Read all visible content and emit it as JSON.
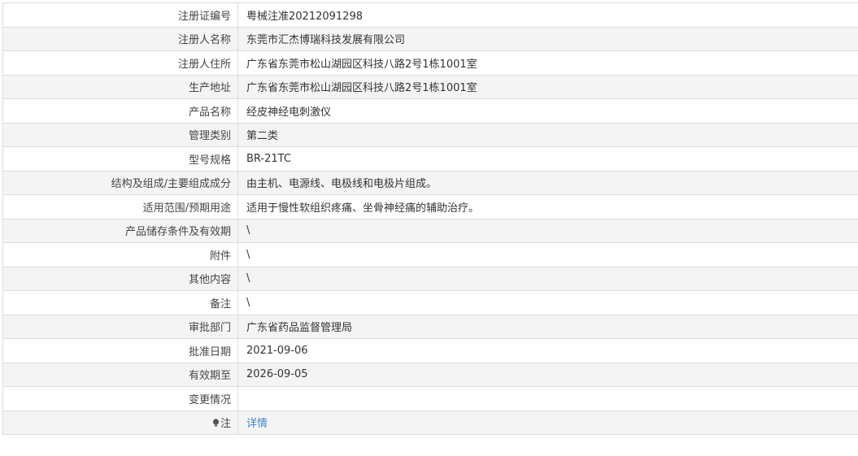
{
  "rows": [
    {
      "label": "注册证编号",
      "value": "粤械注准20212091298"
    },
    {
      "label": "注册人名称",
      "value": "东莞市汇杰博瑞科技发展有限公司"
    },
    {
      "label": "注册人住所",
      "value": "广东省东莞市松山湖园区科技八路2号1栋1001室"
    },
    {
      "label": "生产地址",
      "value": "广东省东莞市松山湖园区科技八路2号1栋1001室"
    },
    {
      "label": "产品名称",
      "value": "经皮神经电刺激仪"
    },
    {
      "label": "管理类别",
      "value": "第二类"
    },
    {
      "label": "型号规格",
      "value": "BR-21TC"
    },
    {
      "label": "结构及组成/主要组成成分",
      "value": "由主机、电源线、电极线和电极片组成。"
    },
    {
      "label": "适用范围/预期用途",
      "value": "适用于慢性软组织疼痛、坐骨神经痛的辅助治疗。"
    },
    {
      "label": "产品储存条件及有效期",
      "value": "\\"
    },
    {
      "label": "附件",
      "value": "\\"
    },
    {
      "label": "其他内容",
      "value": "\\"
    },
    {
      "label": "备注",
      "value": "\\"
    },
    {
      "label": "审批部门",
      "value": "广东省药品监督管理局"
    },
    {
      "label": "批准日期",
      "value": "2021-09-06"
    },
    {
      "label": "有效期至",
      "value": "2026-09-05"
    },
    {
      "label": "变更情况",
      "value": ""
    }
  ],
  "note": {
    "icon": "lightbulb-icon",
    "label": "注",
    "link_text": "详情",
    "link_color": "#3f86c8"
  }
}
